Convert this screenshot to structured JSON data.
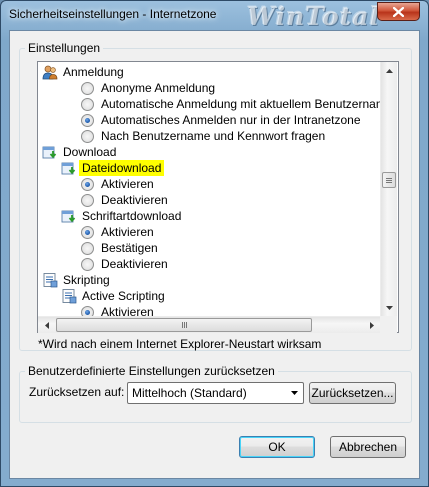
{
  "window": {
    "title": "Sicherheitseinstellungen - Internetzone",
    "watermark": "WinTotal"
  },
  "settings": {
    "group_label": "Einstellungen",
    "tree": [
      {
        "kind": "category",
        "label": "Anmeldung",
        "icon": "users-icon"
      },
      {
        "kind": "option",
        "label": "Anonyme Anmeldung",
        "checked": false
      },
      {
        "kind": "option",
        "label": "Automatische Anmeldung mit aktuellem Benutzernamen u",
        "checked": false
      },
      {
        "kind": "option",
        "label": "Automatisches Anmelden nur in der Intranetzone",
        "checked": true
      },
      {
        "kind": "option",
        "label": "Nach Benutzername und Kennwort fragen",
        "checked": false
      },
      {
        "kind": "category",
        "label": "Download",
        "icon": "download-icon"
      },
      {
        "kind": "subcategory",
        "label": "Dateidownload",
        "icon": "download-icon",
        "highlighted": true
      },
      {
        "kind": "option",
        "label": "Aktivieren",
        "checked": true
      },
      {
        "kind": "option",
        "label": "Deaktivieren",
        "checked": false
      },
      {
        "kind": "subcategory",
        "label": "Schriftartdownload",
        "icon": "download-icon"
      },
      {
        "kind": "option",
        "label": "Aktivieren",
        "checked": true
      },
      {
        "kind": "option",
        "label": "Bestätigen",
        "checked": false
      },
      {
        "kind": "option",
        "label": "Deaktivieren",
        "checked": false
      },
      {
        "kind": "category",
        "label": "Skripting",
        "icon": "script-icon"
      },
      {
        "kind": "subcategory",
        "label": "Active Scripting",
        "icon": "script-icon"
      },
      {
        "kind": "option",
        "label": "Aktivieren",
        "checked": true
      }
    ],
    "note": "*Wird nach einem Internet Explorer-Neustart wirksam"
  },
  "reset": {
    "group_label": "Benutzerdefinierte Einstellungen zurücksetzen",
    "label": "Zurücksetzen auf:",
    "selected": "Mittelhoch (Standard)",
    "button": "Zurücksetzen..."
  },
  "footer": {
    "ok": "OK",
    "cancel": "Abbrechen"
  }
}
